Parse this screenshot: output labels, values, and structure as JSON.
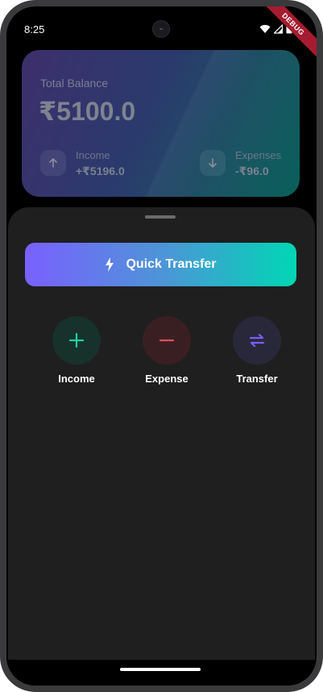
{
  "status": {
    "time": "8:25",
    "debug_label": "DEBUG"
  },
  "balance": {
    "title": "Total Balance",
    "amount": "₹5100.0",
    "income_label": "Income",
    "income_value": "+₹5196.0",
    "expenses_label": "Expenses",
    "expenses_value": "-₹96.0"
  },
  "sheet": {
    "quick_transfer_label": "Quick Transfer",
    "actions": [
      {
        "label": "Income",
        "icon": "plus-icon",
        "color": "#1fd1a5"
      },
      {
        "label": "Expense",
        "icon": "minus-icon",
        "color": "#e84a5f"
      },
      {
        "label": "Transfer",
        "icon": "swap-icon",
        "color": "#7b5cff"
      }
    ]
  },
  "colors": {
    "accent_purple": "#7a60ff",
    "accent_teal": "#00d6b4",
    "sheet_bg": "#1f1f1f"
  }
}
